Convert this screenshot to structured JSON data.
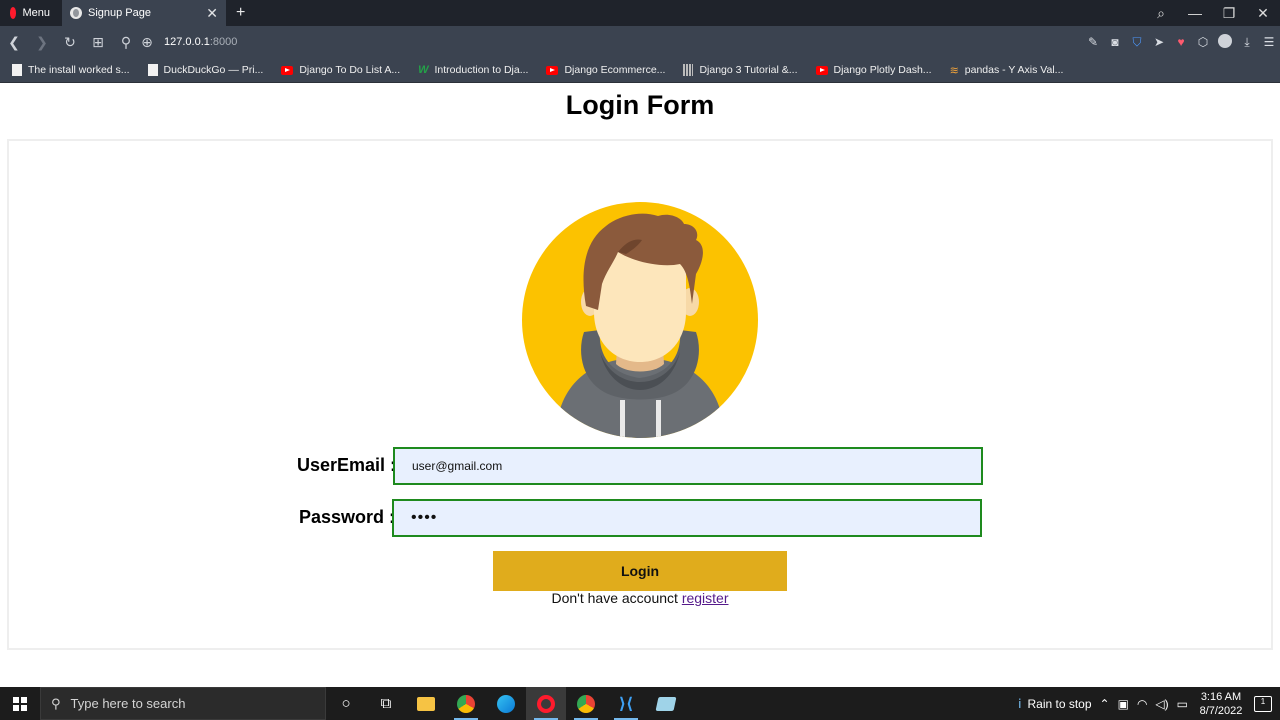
{
  "browser": {
    "menu_label": "Menu",
    "tab_title": "Signup Page",
    "url_host": "127.0.0.1",
    "url_port": ":8000"
  },
  "bookmarks": [
    {
      "label": "The install worked s...",
      "icon": "doc"
    },
    {
      "label": "DuckDuckGo — Pri...",
      "icon": "doc"
    },
    {
      "label": "Django To Do List A...",
      "icon": "youtube"
    },
    {
      "label": "Introduction to Dja...",
      "icon": "w"
    },
    {
      "label": "Django Ecommerce...",
      "icon": "youtube"
    },
    {
      "label": "Django 3 Tutorial &...",
      "icon": "bars"
    },
    {
      "label": "Django Plotly Dash...",
      "icon": "youtube"
    },
    {
      "label": "pandas - Y Axis Val...",
      "icon": "pandas"
    }
  ],
  "page": {
    "title": "Login Form",
    "email_label": "UserEmail :",
    "email_value": "user@gmail.com",
    "password_label": "Password :",
    "password_value": "••••",
    "login_button": "Login",
    "register_prompt": "Don't have accounct",
    "register_link": "register"
  },
  "taskbar": {
    "search_placeholder": "Type here to search",
    "weather": "Rain to stop",
    "time": "3:16 AM",
    "date": "8/7/2022",
    "notifications": "1"
  },
  "colors": {
    "avatar_bg": "#fcc200",
    "login_button": "#e0ac1c",
    "input_border": "#1e8a1e",
    "input_bg": "#e8f0fe"
  }
}
